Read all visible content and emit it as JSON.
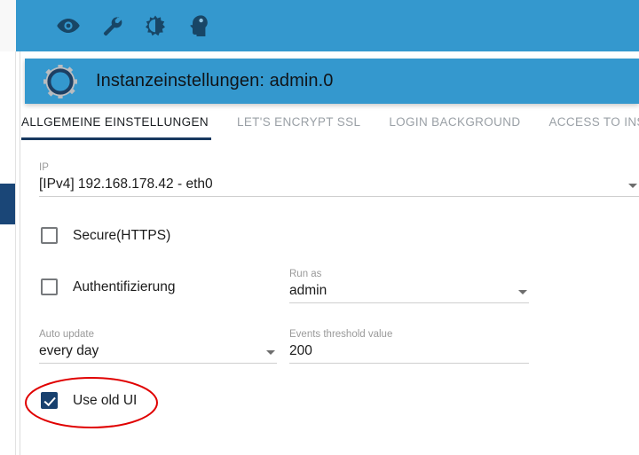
{
  "toolbar": {
    "icons": [
      {
        "name": "eye-icon",
        "label": "Ansicht"
      },
      {
        "name": "wrench-icon",
        "label": "Einstellungen"
      },
      {
        "name": "contrast-icon",
        "label": "Kontrast"
      },
      {
        "name": "expert-head-icon",
        "label": "Expertenmodus"
      }
    ]
  },
  "header": {
    "icon": "gear-icon",
    "title": "Instanzeinstellungen: admin.0",
    "background_color": "#3498ce"
  },
  "tabs": [
    {
      "label": "ALLGEMEINE EINSTELLUNGEN",
      "active": true
    },
    {
      "label": "LET'S ENCRYPT SSL",
      "active": false
    },
    {
      "label": "LOGIN BACKGROUND",
      "active": false
    },
    {
      "label": "ACCESS TO INSTANCES",
      "active": false
    }
  ],
  "form": {
    "ip": {
      "label": "IP",
      "value": "[IPv4] 192.168.178.42 - eth0",
      "type": "select"
    },
    "secure_https": {
      "label": "Secure(HTTPS)",
      "checked": false
    },
    "authentication": {
      "label": "Authentifizierung",
      "checked": false
    },
    "run_as": {
      "label": "Run as",
      "value": "admin",
      "type": "select"
    },
    "auto_update": {
      "label": "Auto update",
      "value": "every day",
      "type": "select"
    },
    "events_threshold": {
      "label": "Events threshold value",
      "value": "200",
      "type": "text"
    },
    "use_old_ui": {
      "label": "Use old UI",
      "checked": true
    }
  },
  "annotation": {
    "shape": "ellipse",
    "color": "#e00000",
    "target": "use-old-ui-checkbox"
  },
  "colors": {
    "accent_blue": "#3498ce",
    "dark_navy": "#17406e",
    "tab_underline": "#17385f",
    "sidebar_block": "#1a4677",
    "annotation_red": "#e00000"
  }
}
